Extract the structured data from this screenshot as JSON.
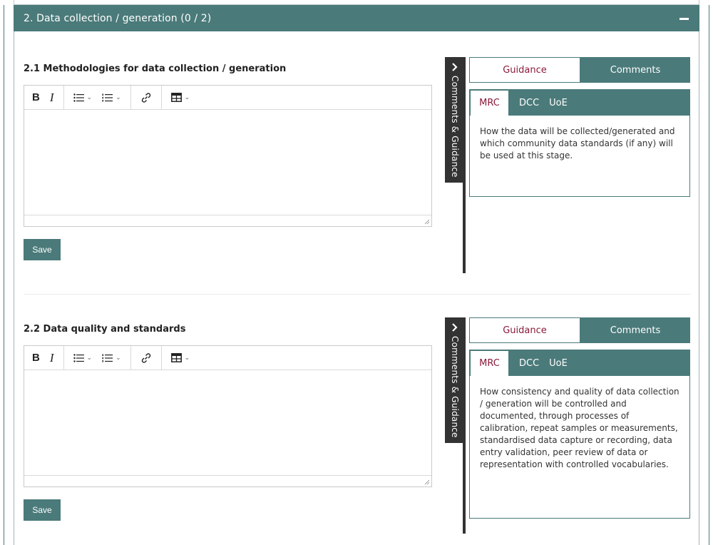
{
  "section": {
    "title": "2. Data collection / generation (0 / 2)"
  },
  "toolbar": {
    "bold": "B",
    "italic": "I"
  },
  "questions": [
    {
      "label": "2.1 Methodologies for data collection / generation",
      "save_label": "Save",
      "side_tab_label": "Comments & Guidance",
      "tabs": {
        "guidance": "Guidance",
        "comments": "Comments"
      },
      "sub_tabs": [
        "MRC",
        "DCC",
        "UoE"
      ],
      "guidance_text": "How the data will be collected/generated and which community data standards (if any) will be used at this stage."
    },
    {
      "label": "2.2 Data quality and standards",
      "save_label": "Save",
      "side_tab_label": "Comments & Guidance",
      "tabs": {
        "guidance": "Guidance",
        "comments": "Comments"
      },
      "sub_tabs": [
        "MRC",
        "DCC",
        "UoE"
      ],
      "guidance_text": "How consistency and quality of data collection / generation will be controlled and documented, through processes of calibration, repeat samples or measurements, standardised data capture or recording, data entry validation, peer review of data or representation with controlled vocabularies."
    }
  ],
  "colors": {
    "accent": "#4b7a7a",
    "active_tab_text": "#8b1a3a",
    "side_tab": "#333333"
  }
}
